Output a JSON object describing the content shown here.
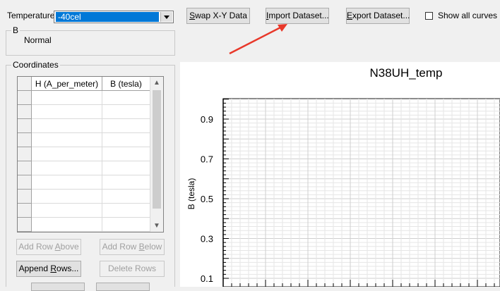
{
  "temperature": {
    "label": "Temperature",
    "value": "-40cel"
  },
  "toolbar": {
    "swap_label": "Swap X-Y Data",
    "import_label": "Import Dataset...",
    "export_label": "Export Dataset...",
    "show_all_label": "Show all curves",
    "show_all_checked": false
  },
  "b_group": {
    "title": "B",
    "value": "Normal"
  },
  "coordinates": {
    "title": "Coordinates",
    "columns": [
      "H (A_per_meter)",
      "B (tesla)"
    ],
    "row_count": 10
  },
  "row_buttons": {
    "add_above": "Add Row Above",
    "add_below": "Add Row Below",
    "append": "Append Rows...",
    "delete": "Delete Rows"
  },
  "annotation": {
    "arrow_color": "#e8382a"
  },
  "chart_data": {
    "type": "line",
    "title": "N38UH_temp",
    "ylabel": "B (tesla)",
    "xlabel": "",
    "ylim": [
      0.1,
      1.0
    ],
    "yticks": [
      "0.9",
      "0.7",
      "0.5",
      "0.3",
      "0.1"
    ],
    "grid": true,
    "series": []
  },
  "colors": {
    "selection": "#0078d7",
    "window": "#f0f0f0"
  }
}
